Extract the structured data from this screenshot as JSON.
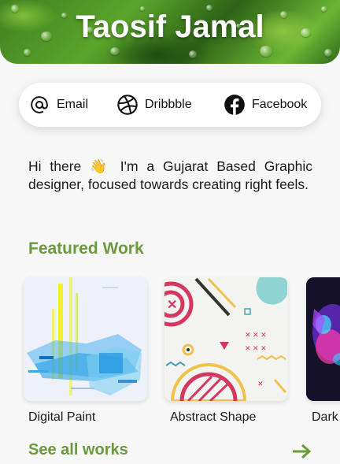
{
  "profile": {
    "name": "Taosif Jamal"
  },
  "social": [
    {
      "label": "Email",
      "icon": "at-icon"
    },
    {
      "label": "Dribbble",
      "icon": "dribbble-icon"
    },
    {
      "label": "Facebook",
      "icon": "facebook-icon"
    }
  ],
  "bio": "Hi there 👋 I'm a Gujarat Based Graphic designer, focused towards creating right feels.",
  "featured": {
    "title": "Featured Work",
    "items": [
      {
        "label": "Digital Paint"
      },
      {
        "label": "Abstract Shape"
      },
      {
        "label": "Dark"
      }
    ],
    "see_all": "See all works"
  },
  "colors": {
    "accent": "#6a9a3b",
    "card_bg": "#ffffff",
    "page_bg": "#f7f7f7"
  }
}
